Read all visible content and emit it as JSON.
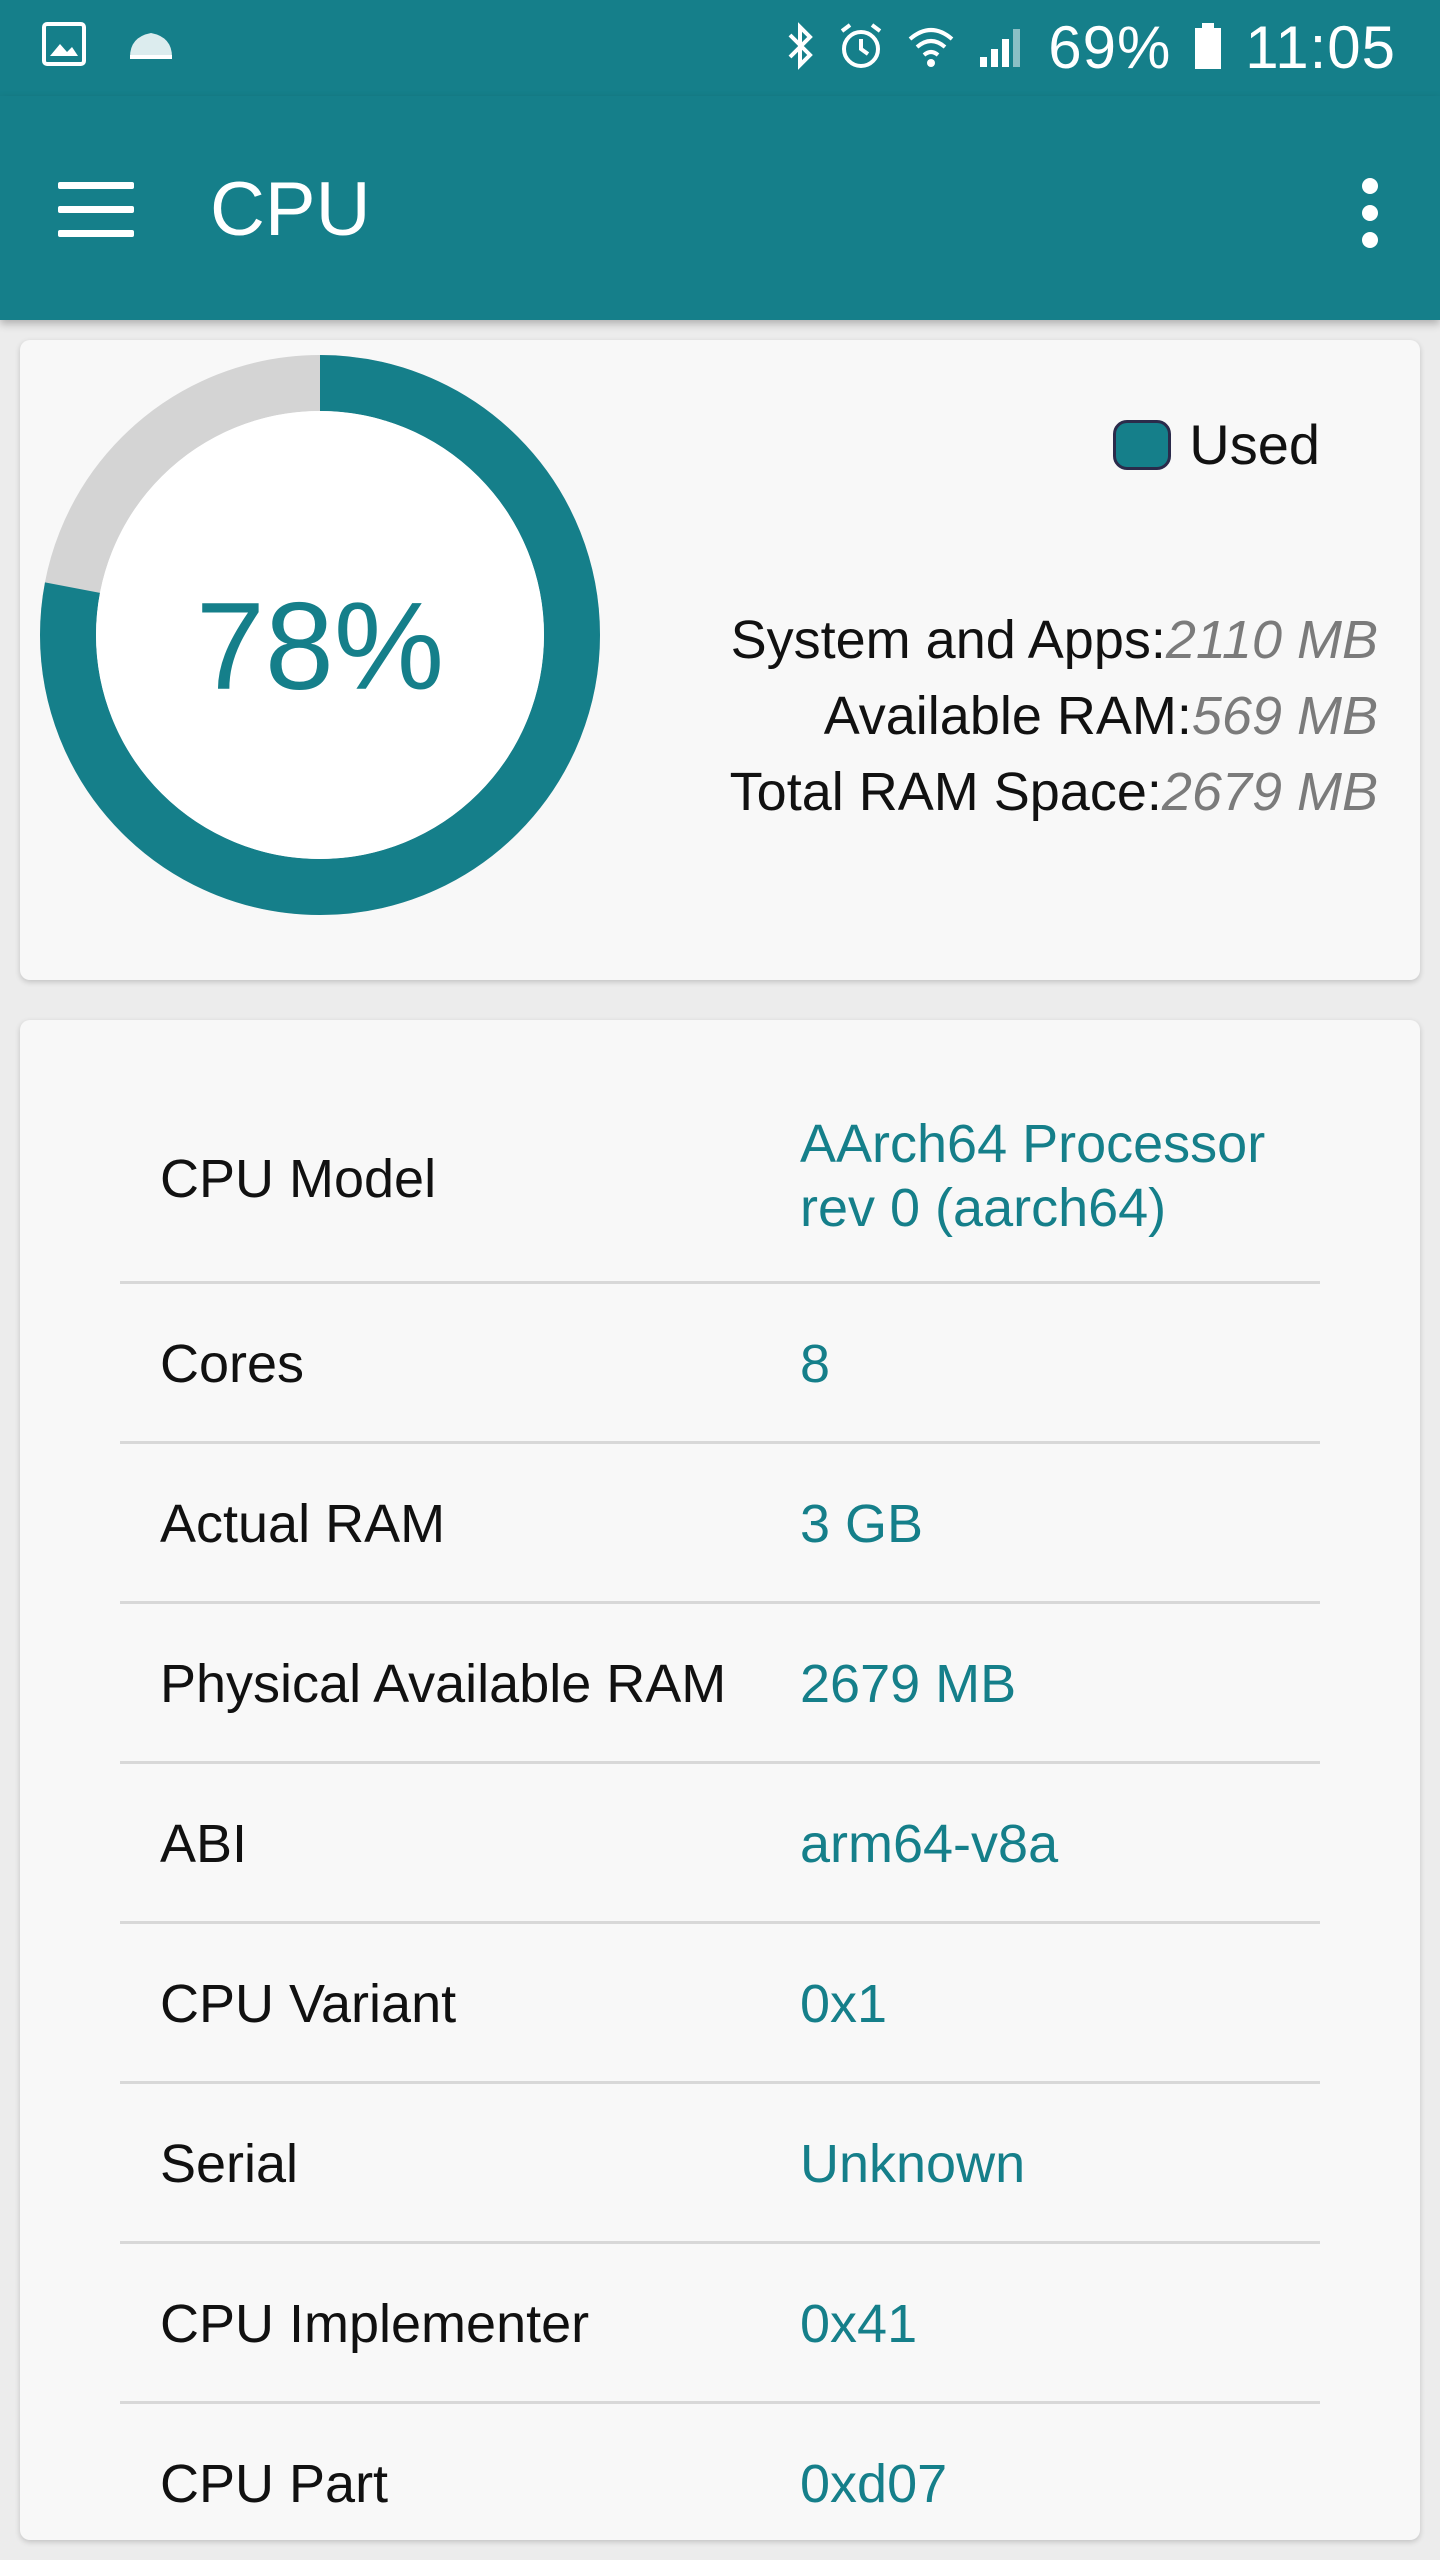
{
  "status_bar": {
    "battery": "69%",
    "time": "11:05",
    "icons": [
      "gallery-icon",
      "cloud-icon",
      "bluetooth-icon",
      "alarm-icon",
      "wifi-icon",
      "signal-icon",
      "battery-icon"
    ]
  },
  "app_bar": {
    "title": "CPU",
    "menu_icon": "hamburger-menu-icon",
    "overflow_icon": "more-vert-icon"
  },
  "ram": {
    "used_percent": 78,
    "used_percent_label": "78%",
    "legend_label": "Used",
    "stats": [
      {
        "label": "System and Apps:",
        "value": "2110 MB"
      },
      {
        "label": "Available RAM:",
        "value": "569 MB"
      },
      {
        "label": "Total RAM Space:",
        "value": "2679 MB"
      }
    ]
  },
  "info_rows": [
    {
      "label": "CPU Model",
      "value": "AArch64 Processor rev 0 (aarch64)"
    },
    {
      "label": "Cores",
      "value": "8"
    },
    {
      "label": "Actual RAM",
      "value": "3 GB"
    },
    {
      "label": "Physical Available RAM",
      "value": "2679 MB"
    },
    {
      "label": "ABI",
      "value": "arm64-v8a"
    },
    {
      "label": "CPU Variant",
      "value": "0x1"
    },
    {
      "label": "Serial",
      "value": "Unknown"
    },
    {
      "label": "CPU Implementer",
      "value": "0x41"
    },
    {
      "label": "CPU Part",
      "value": "0xd07"
    }
  ],
  "colors": {
    "accent": "#157f8a",
    "track": "#d4d4d4",
    "card_bg": "#f8f8f8"
  }
}
